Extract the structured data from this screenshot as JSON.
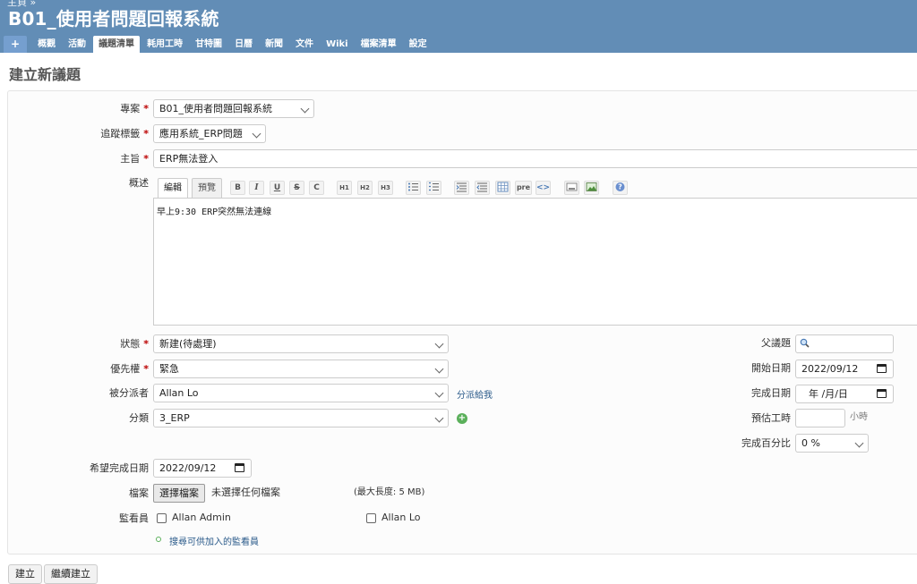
{
  "header": {
    "project_title": "B01_使用者問題回報系統",
    "crumb": "主頁 »"
  },
  "menu": {
    "new": "+",
    "tabs": [
      "概觀",
      "活動",
      "議題清單",
      "耗用工時",
      "甘特圖",
      "日曆",
      "新聞",
      "文件",
      "Wiki",
      "檔案清單",
      "設定"
    ],
    "selected": "議題清單"
  },
  "page": {
    "heading": "建立新議題"
  },
  "form": {
    "project": {
      "label": "專案",
      "value": "B01_使用者問題回報系統"
    },
    "tracker": {
      "label": "追蹤標籤",
      "value": "應用系統_ERP問題"
    },
    "subject": {
      "label": "主旨",
      "value": "ERP無法登入"
    },
    "description": {
      "label": "概述",
      "tab_edit": "編輯",
      "tab_preview": "預覽",
      "text": "早上9:30 ERP突然無法連線",
      "toolbar": [
        "B",
        "I",
        "U",
        "S",
        "C",
        "H1",
        "H2",
        "H3",
        "ul",
        "ol",
        "quote",
        "unquote",
        "table",
        "pre",
        "code",
        "link",
        "image",
        "help"
      ]
    },
    "status": {
      "label": "狀態",
      "value": "新建(待處理)"
    },
    "priority": {
      "label": "優先權",
      "value": "緊急"
    },
    "assignee": {
      "label": "被分派者",
      "value": "Allan Lo",
      "assign_to_me": "分派給我"
    },
    "category": {
      "label": "分類",
      "value": "3_ERP"
    },
    "parent": {
      "label": "父議題",
      "value": ""
    },
    "start_date": {
      "label": "開始日期",
      "value": "2022/09/12"
    },
    "due_date": {
      "label": "完成日期",
      "value": "年 /月/日"
    },
    "estimated": {
      "label": "預估工時",
      "value": "",
      "unit": "小時"
    },
    "done_ratio": {
      "label": "完成百分比",
      "value": "0 %"
    },
    "expected_date": {
      "label": "希望完成日期",
      "value": "2022/09/12"
    },
    "files": {
      "label": "檔案",
      "button": "選擇檔案",
      "no_file": "未選擇任何檔案",
      "max_size": "(最大長度: 5 MB)"
    },
    "watchers": {
      "label": "監看員",
      "users": [
        "Allan Admin",
        "Allan Lo"
      ],
      "search_link": "搜尋可供加入的監看員"
    }
  },
  "actions": {
    "create": "建立",
    "create_continue": "繼續建立"
  }
}
